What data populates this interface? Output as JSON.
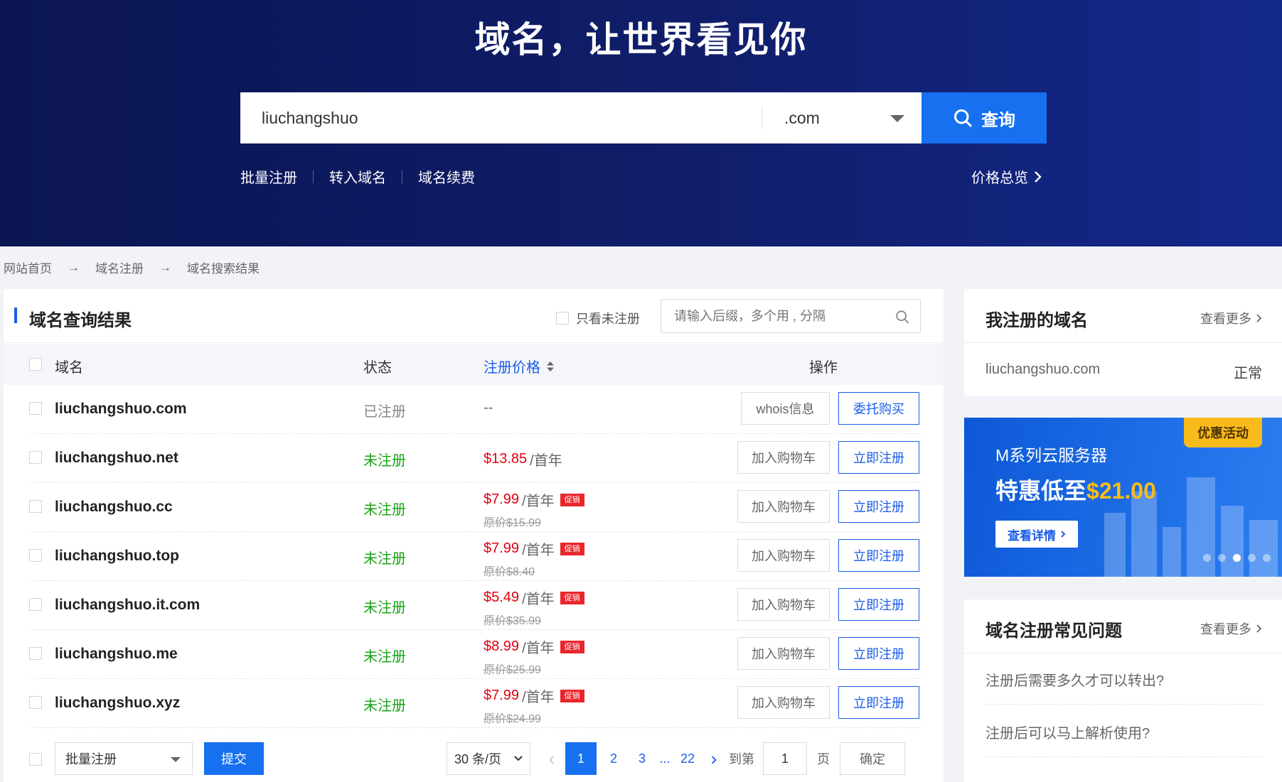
{
  "hero": {
    "title": "域名，让世界看见你",
    "search_value": "liuchangshuo",
    "suffix": ".com",
    "search_button": "查询",
    "links": [
      "批量注册",
      "转入域名",
      "域名续费"
    ],
    "price_overview": "价格总览"
  },
  "breadcrumb": [
    "网站首页",
    "域名注册",
    "域名搜索结果"
  ],
  "results": {
    "title": "域名查询结果",
    "only_unregistered": "只看未注册",
    "filter_placeholder": "请输入后缀，多个用 , 分隔",
    "columns": {
      "domain": "域名",
      "status": "状态",
      "price": "注册价格",
      "ops": "操作"
    },
    "rows": [
      {
        "domain": "liuchangshuo.com",
        "status": "已注册",
        "price": "--",
        "unit": "",
        "promo": "",
        "orig": "",
        "btn1": "whois信息",
        "btn2": "委托购买"
      },
      {
        "domain": "liuchangshuo.net",
        "status": "未注册",
        "price": "$13.85",
        "unit": "/首年",
        "promo": "",
        "orig": "",
        "btn1": "加入购物车",
        "btn2": "立即注册"
      },
      {
        "domain": "liuchangshuo.cc",
        "status": "未注册",
        "price": "$7.99",
        "unit": "/首年",
        "promo": "促销",
        "orig": "原价$15.99",
        "btn1": "加入购物车",
        "btn2": "立即注册"
      },
      {
        "domain": "liuchangshuo.top",
        "status": "未注册",
        "price": "$7.99",
        "unit": "/首年",
        "promo": "促销",
        "orig": "原价$8.40",
        "btn1": "加入购物车",
        "btn2": "立即注册"
      },
      {
        "domain": "liuchangshuo.it.com",
        "status": "未注册",
        "price": "$5.49",
        "unit": "/首年",
        "promo": "促销",
        "orig": "原价$35.99",
        "btn1": "加入购物车",
        "btn2": "立即注册"
      },
      {
        "domain": "liuchangshuo.me",
        "status": "未注册",
        "price": "$8.99",
        "unit": "/首年",
        "promo": "促销",
        "orig": "原价$25.99",
        "btn1": "加入购物车",
        "btn2": "立即注册"
      },
      {
        "domain": "liuchangshuo.xyz",
        "status": "未注册",
        "price": "$7.99",
        "unit": "/首年",
        "promo": "促销",
        "orig": "原价$24.99",
        "btn1": "加入购物车",
        "btn2": "立即注册"
      }
    ],
    "footer": {
      "batch_select": "批量注册",
      "submit": "提交",
      "page_size": "30 条/页",
      "pages": [
        "1",
        "2",
        "3",
        "...",
        "22"
      ],
      "goto_label": "到第",
      "goto_value": "1",
      "page_label": "页",
      "confirm": "确定"
    }
  },
  "sidebar": {
    "my_domains": {
      "title": "我注册的域名",
      "more": "查看更多",
      "domain": "liuchangshuo.com",
      "status": "正常"
    },
    "banner": {
      "tag": "优惠活动",
      "title": "M系列云服务器",
      "sub_prefix": "特惠低至",
      "sub_amount": "$21.00",
      "button": "查看详情",
      "active_dot": 2,
      "dot_count": 5
    },
    "faq": {
      "title": "域名注册常见问题",
      "more": "查看更多",
      "items": [
        "注册后需要多久才可以转出?",
        "注册后可以马上解析使用?"
      ]
    }
  },
  "colors": {
    "accent": "#1670f0",
    "price_red": "#e3000f",
    "unreg_green": "#17a317",
    "promo_tag": "#f9bb1b"
  }
}
